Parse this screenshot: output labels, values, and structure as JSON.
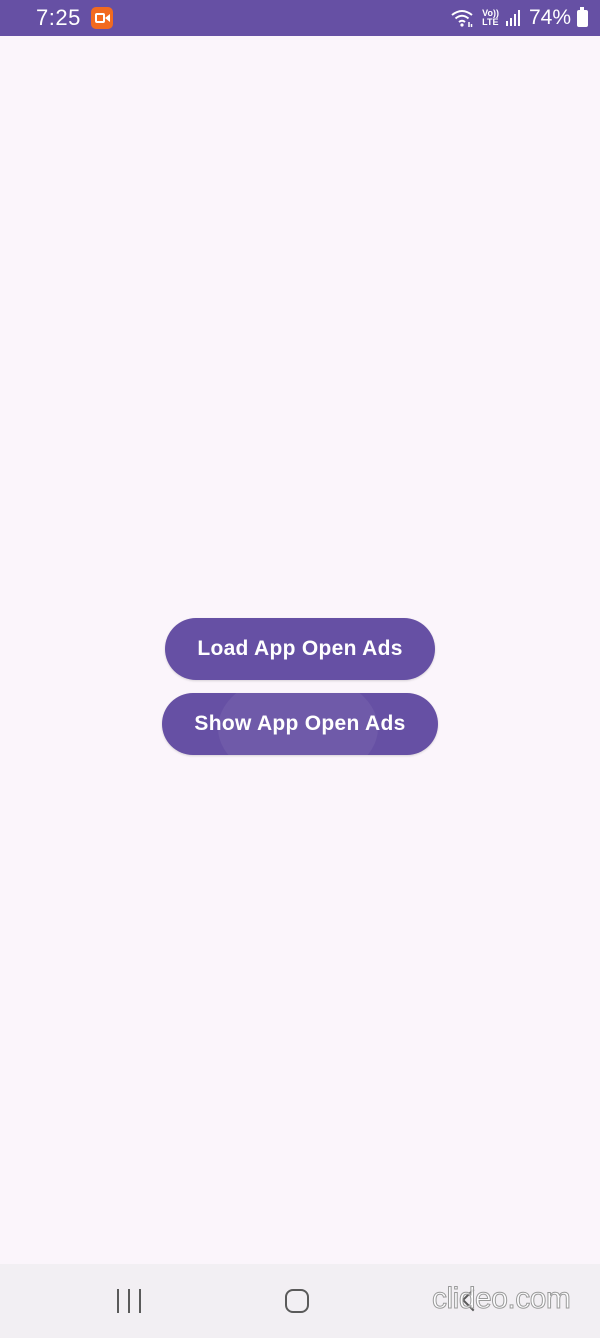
{
  "status_bar": {
    "time": "7:25",
    "network_top": "Vo))",
    "network_bottom": "LTE",
    "battery_percent": "74%",
    "icons": [
      "screen-recorder-icon",
      "wifi-icon",
      "signal-icon",
      "battery-charging-icon"
    ]
  },
  "main": {
    "load_button_label": "Load App Open Ads",
    "show_button_label": "Show App Open Ads"
  },
  "nav_bar": {
    "icons": [
      "recent-apps-icon",
      "home-icon",
      "back-icon"
    ]
  },
  "watermark": {
    "text": "clideo.com"
  },
  "colors": {
    "primary": "#6650a4",
    "background": "#fbf5fb",
    "nav_bar_bg": "#f2eff3",
    "recorder_badge": "#f26a1f"
  }
}
